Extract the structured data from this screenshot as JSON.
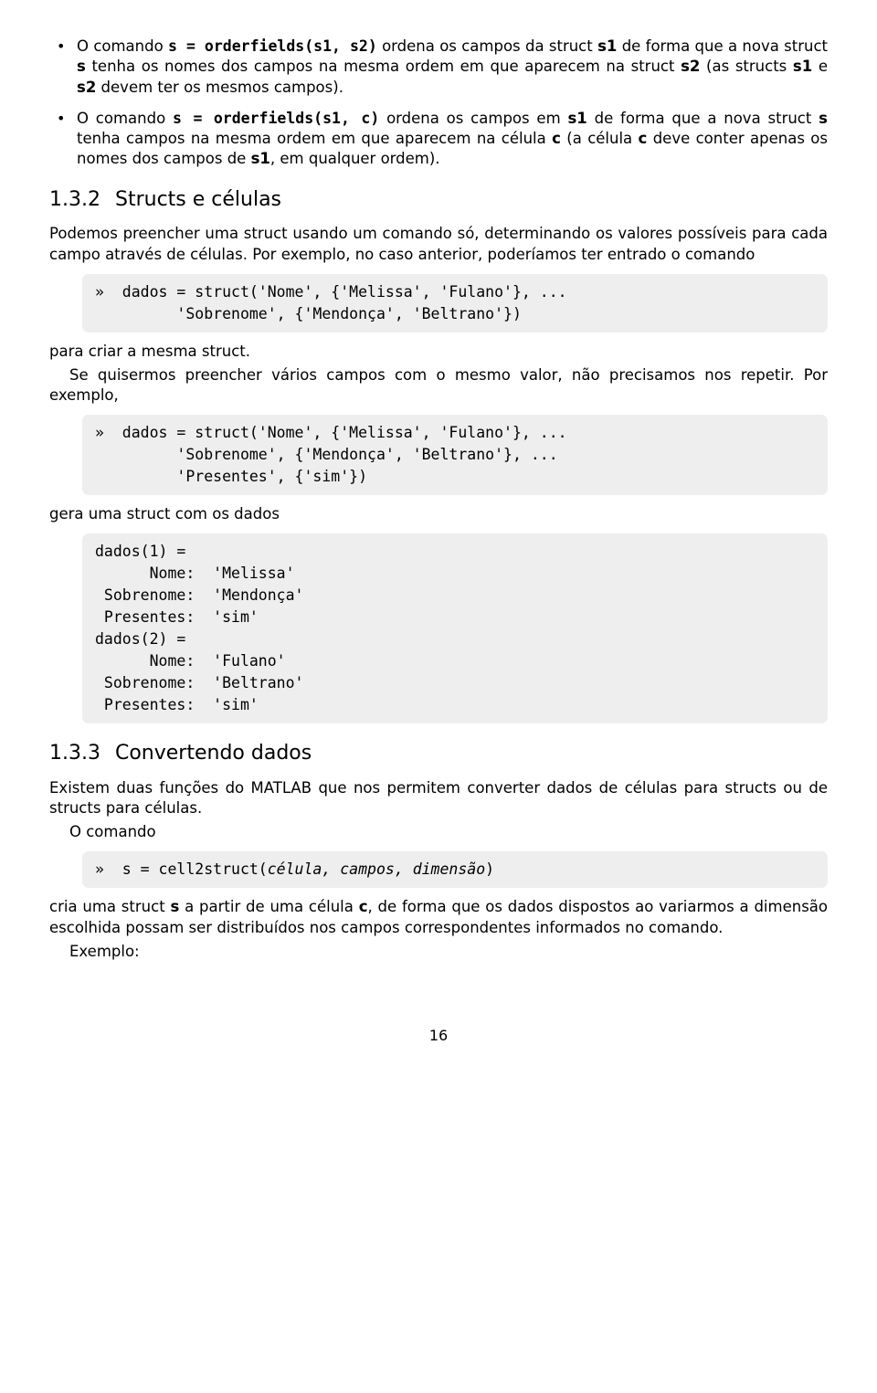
{
  "bullets": [
    {
      "prefix": "O comando ",
      "code": "s = orderfields(s1, s2)",
      "rest": " ordena os campos da struct <b>s1</b> de forma que a nova struct <b>s</b> tenha os nomes dos campos na mesma ordem em que aparecem na struct <b>s2</b> (as structs <b>s1</b> e <b>s2</b> devem ter os mesmos campos)."
    },
    {
      "prefix": "O comando ",
      "code": "s = orderfields(s1, c)",
      "rest": " ordena os campos em <b>s1</b> de forma que a nova struct <b>s</b> tenha campos na mesma ordem em que aparecem na célula <b>c</b> (a célula <b>c</b> deve conter apenas os nomes dos campos de <b>s1</b>, em qualquer ordem)."
    }
  ],
  "sec132": {
    "num": "1.3.2",
    "title": "Structs e células",
    "p1": "Podemos preencher uma struct usando um comando só, determinando os valores possíveis para cada campo através de células. Por exemplo, no caso anterior, poderíamos ter entrado o comando",
    "code1": "»  dados = struct('Nome', {'Melissa', 'Fulano'}, ...\n         'Sobrenome', {'Mendonça', 'Beltrano'})",
    "p2a": "para criar a mesma struct.",
    "p2b": "Se quisermos preencher vários campos com o mesmo valor, não precisamos nos repetir. Por exemplo,",
    "code2": "»  dados = struct('Nome', {'Melissa', 'Fulano'}, ...\n         'Sobrenome', {'Mendonça', 'Beltrano'}, ...\n         'Presentes', {'sim'})",
    "p3": "gera uma struct com os dados",
    "code3": "dados(1) =\n      Nome:  'Melissa'\n Sobrenome:  'Mendonça'\n Presentes:  'sim'\ndados(2) =\n      Nome:  'Fulano'\n Sobrenome:  'Beltrano'\n Presentes:  'sim'"
  },
  "sec133": {
    "num": "1.3.3",
    "title": "Convertendo dados",
    "p1": "Existem duas funções do MATLAB que nos permitem converter dados de células para structs ou de structs para células.",
    "p1b": "O comando",
    "code1_pre": "»  s = cell2struct(",
    "code1_args": "célula, campos, dimensão",
    "code1_post": ")",
    "p2": "cria uma struct <b>s</b> a partir de uma célula <b>c</b>, de forma que os dados dispostos ao variarmos a dimensão escolhida possam ser distribuídos nos campos correspondentes informados no comando.",
    "p2b": "Exemplo:"
  },
  "pagenum": "16"
}
